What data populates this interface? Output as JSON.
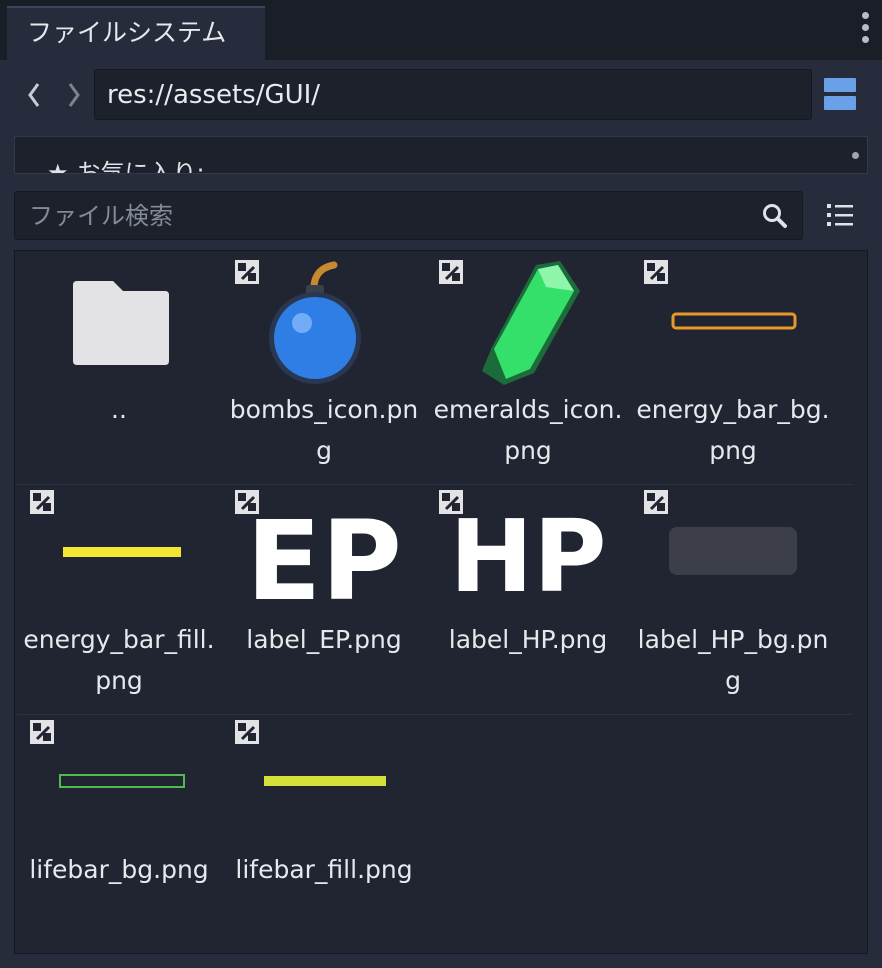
{
  "dock": {
    "tab_title": "ファイルシステム",
    "menu_icon": "kebab-menu-icon"
  },
  "nav": {
    "back_icon": "chevron-left-icon",
    "forward_icon": "chevron-right-icon",
    "path": "res://assets/GUI/",
    "split_icon": "split-view-icon"
  },
  "favorites": {
    "icon": "star-icon",
    "label": "お気に入り:"
  },
  "search": {
    "placeholder": "ファイル検索",
    "icon": "search-icon",
    "list_icon": "list-view-icon"
  },
  "files": [
    {
      "name": "..",
      "type": "folder"
    },
    {
      "name": "bombs_icon.png",
      "type": "image"
    },
    {
      "name": "emeralds_icon.png",
      "type": "image"
    },
    {
      "name": "energy_bar_bg.png",
      "type": "image"
    },
    {
      "name": "energy_bar_fill.png",
      "type": "image"
    },
    {
      "name": "label_EP.png",
      "type": "image"
    },
    {
      "name": "label_HP.png",
      "type": "image"
    },
    {
      "name": "label_HP_bg.png",
      "type": "image"
    },
    {
      "name": "lifebar_bg.png",
      "type": "image"
    },
    {
      "name": "lifebar_fill.png",
      "type": "image"
    }
  ],
  "thumbnail_text": {
    "ep": "EP",
    "hp": "HP"
  },
  "colors": {
    "accent": "#6aa0e8",
    "energy_bar_bg": "#e89a28",
    "energy_bar_fill": "#f4e631",
    "lifebar_bg": "#4cbc4c",
    "lifebar_fill": "#d6e03a",
    "label_hp_bg": "#3c3f47",
    "bomb": "#2f7ee6",
    "emerald": "#34e06a"
  }
}
